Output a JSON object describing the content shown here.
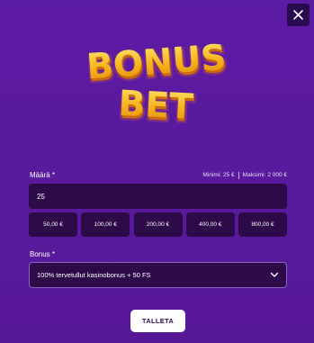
{
  "modal": {
    "close_icon": "close-icon"
  },
  "logo": {
    "line1": "BONUS",
    "line2": "BET",
    "colors": {
      "fill": "#f6b21b",
      "shade": "#c96a0c",
      "outline": "#7a2c8a",
      "highlight": "#ffe46b"
    }
  },
  "amount": {
    "label": "Määrä",
    "required_mark": "*",
    "min_label": "Minimi:",
    "min_value": "25 €",
    "max_label": "Maksimi:",
    "max_value": "2 000 €",
    "value": "25",
    "quick_amounts": [
      "50,00 €",
      "100,00 €",
      "200,00 €",
      "400,00 €",
      "800,00 €"
    ]
  },
  "bonus": {
    "label": "Bonus",
    "required_mark": "*",
    "selected": "100% tervetullut kasinobonus + 50 FS",
    "dropdown_icon": "chevron-down-icon"
  },
  "actions": {
    "deposit_label": "TALLETA"
  },
  "colors": {
    "background": "#5a1a9e",
    "field_bg": "#2d0a48",
    "button_bg": "#ffffff",
    "button_text": "#2a0b4f"
  }
}
